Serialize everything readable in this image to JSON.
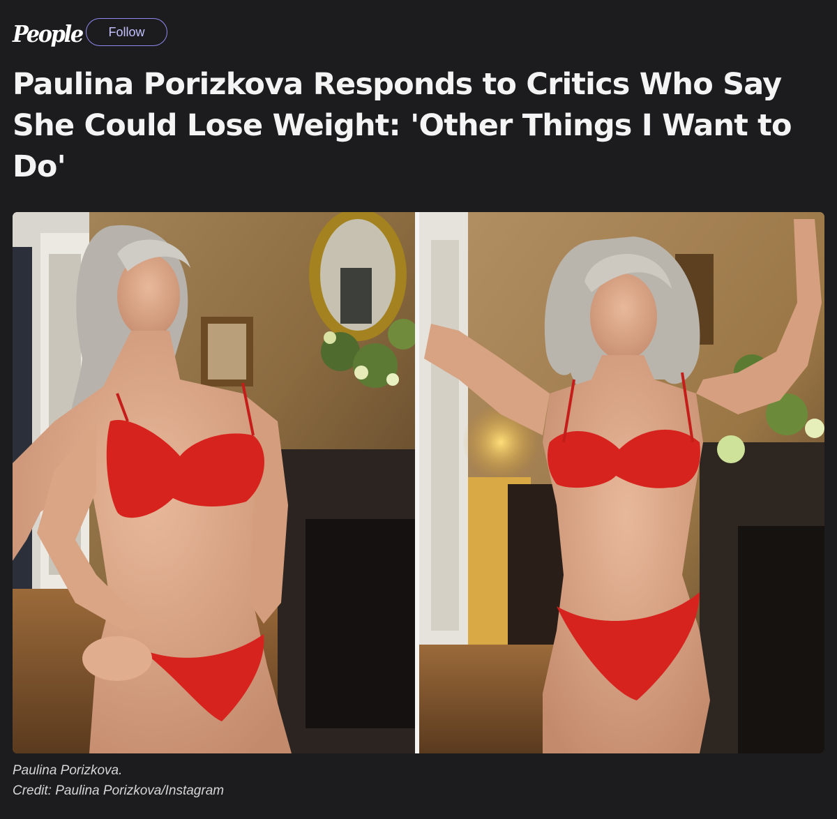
{
  "publisher": {
    "logo_text": "People",
    "follow_label": "Follow",
    "accent_color": "#8f8af0"
  },
  "article": {
    "headline": "Paulina Porizkova Responds to Critics Who Say She Could Lose Weight: 'Other Things I Want to Do'"
  },
  "image": {
    "description_panels": [
      "left-photo",
      "right-photo"
    ]
  },
  "caption": {
    "text": "Paulina Porizkova.",
    "credit": "Credit: Paulina Porizkova/Instagram"
  }
}
